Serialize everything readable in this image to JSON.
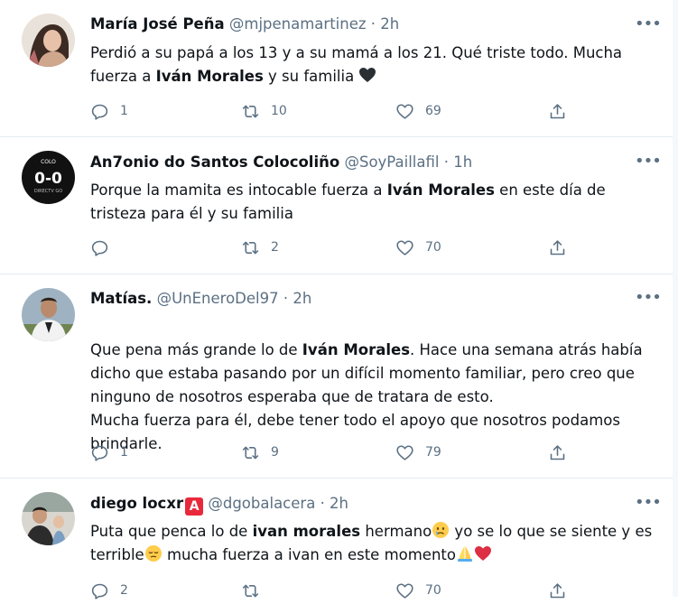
{
  "tweets": [
    {
      "name": "María José Peña",
      "handle": "@mjpenamartinez",
      "time": "· 2h",
      "text": [
        {
          "t": "Perdió a su papá a los 13 y a su mamá a los 21. Qué triste todo. Mucha fuerza a "
        },
        {
          "t": "Iván Morales",
          "b": true
        },
        {
          "t": " y su familia "
        }
      ],
      "replies": "1",
      "retweets": "10",
      "likes": "69"
    },
    {
      "name": "An7onio do Santos Colocoliño",
      "handle": "@SoyPaillafil",
      "time": "· 1h",
      "text": [
        {
          "t": "Porque la mamita es intocable fuerza a "
        },
        {
          "t": "Iván Morales",
          "b": true
        },
        {
          "t": " en este día de tristeza para él y su familia"
        }
      ],
      "replies": "",
      "retweets": "2",
      "likes": "70"
    },
    {
      "name": "Matías.",
      "handle": "@UnEneroDel97",
      "time": "· 2h",
      "text": [
        {
          "t": "Que pena más grande lo de "
        },
        {
          "t": "Iván Morales",
          "b": true
        },
        {
          "t": ". Hace una semana atrás había dicho que estaba pasando por un difícil momento familiar, pero creo que ninguno de nosotros esperaba que de tratara de esto.\nMucha fuerza para él, debe tener todo el apoyo que nosotros podamos brindarle."
        }
      ],
      "replies": "1",
      "retweets": "9",
      "likes": "79"
    },
    {
      "name": "diego locxr",
      "badge": "A",
      "handle": "@dgobalacera",
      "time": "· 2h",
      "text": [
        {
          "t": "Puta que penca lo de "
        },
        {
          "t": "ivan morales",
          "b": true
        },
        {
          "t": " hermano"
        },
        {
          "t": " yo se lo que se siente y es terrible"
        },
        {
          "t": " mucha fuerza a ivan en este momento"
        }
      ],
      "replies": "2",
      "retweets": "",
      "likes": "70"
    }
  ],
  "icons": {
    "reply": "reply-icon",
    "retweet": "retweet-icon",
    "like": "heart-icon",
    "share": "share-icon",
    "more": "more-icon"
  },
  "colors": {
    "muted": "#5b7083",
    "border": "#e6ecf0",
    "text": "#0f1419",
    "badge": "#e8293b"
  },
  "more_label": "•••"
}
